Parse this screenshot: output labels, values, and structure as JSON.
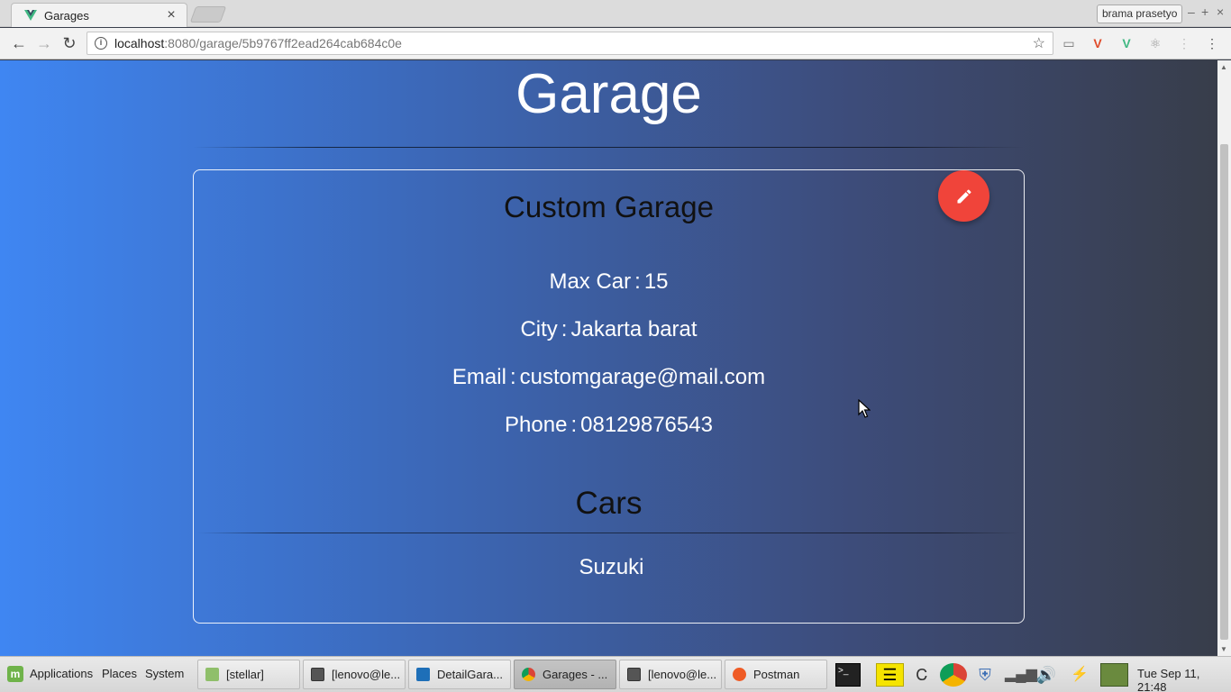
{
  "browser": {
    "tab_title": "Garages",
    "tab_close": "×",
    "profile_name": "brama prasetyo",
    "url_host": "localhost",
    "url_path": ":8080/garage/5b9767ff2ead264cab684c0e",
    "window_controls": {
      "minimize": "–",
      "maximize": "+",
      "close": "×"
    }
  },
  "page": {
    "title": "Garage",
    "garage": {
      "name": "Custom Garage",
      "fields": [
        {
          "label": "Max Car",
          "sep": ":",
          "value": "15"
        },
        {
          "label": "City",
          "sep": ":",
          "value": "Jakarta barat"
        },
        {
          "label": "Email",
          "sep": ":",
          "value": "customgarage@mail.com"
        },
        {
          "label": "Phone",
          "sep": ":",
          "value": "08129876543"
        }
      ]
    },
    "cars_title": "Cars",
    "cars": [
      "Suzuki"
    ],
    "edit_icon": "pencil-icon",
    "accent_color": "#f0443a"
  },
  "taskbar": {
    "menu": [
      "Applications",
      "Places",
      "System"
    ],
    "tasks": [
      {
        "label": "[stellar]",
        "icon": "folder-icon"
      },
      {
        "label": "[lenovo@le...",
        "icon": "terminal-icon"
      },
      {
        "label": "DetailGara...",
        "icon": "vscode-icon"
      },
      {
        "label": "Garages - ...",
        "icon": "chrome-icon"
      },
      {
        "label": "[lenovo@le...",
        "icon": "terminal-icon"
      },
      {
        "label": "Postman",
        "icon": "postman-icon"
      }
    ],
    "clock": "Tue Sep 11, 21:48"
  }
}
